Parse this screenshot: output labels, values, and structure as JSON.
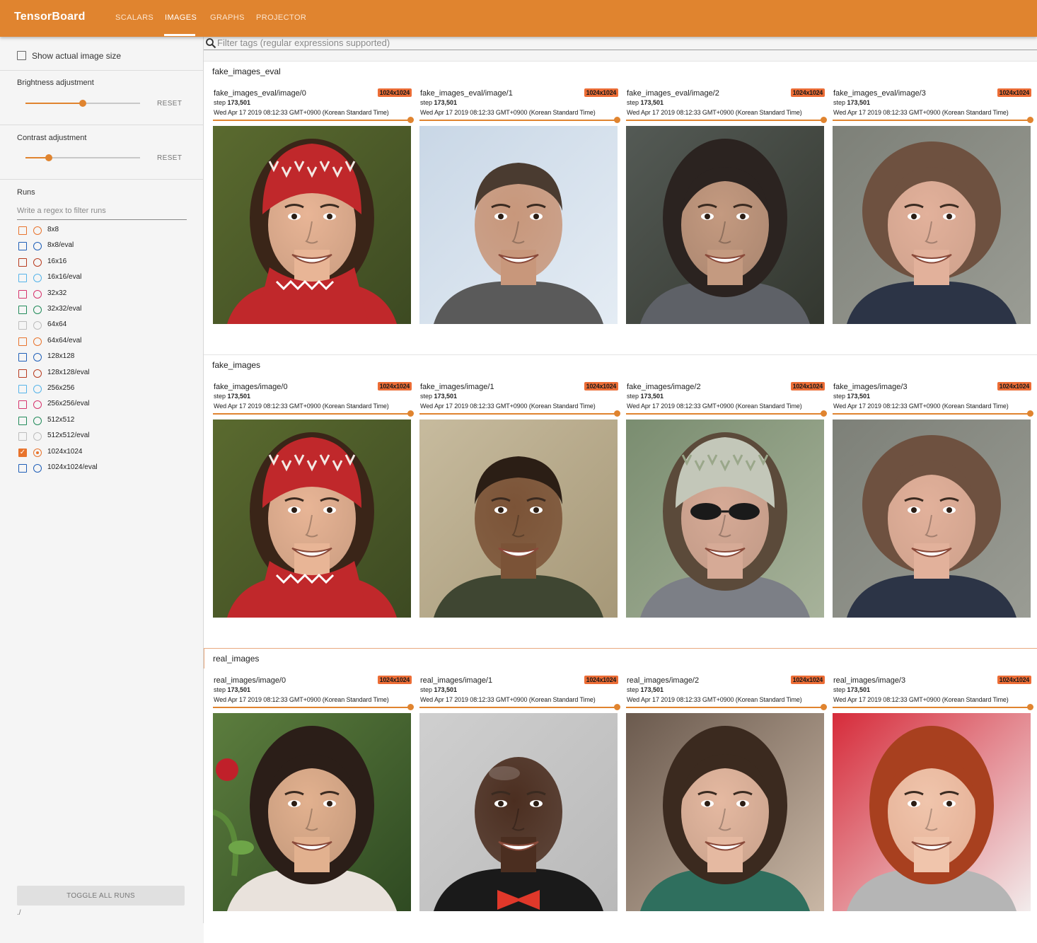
{
  "app": {
    "title": "TensorBoard",
    "tabs": [
      "SCALARS",
      "IMAGES",
      "GRAPHS",
      "PROJECTOR"
    ],
    "active_tab": "IMAGES",
    "accent": "#e0842f"
  },
  "sidebar": {
    "show_actual_size_label": "Show actual image size",
    "show_actual_size_checked": false,
    "brightness_label": "Brightness adjustment",
    "brightness_value": 0.5,
    "contrast_label": "Contrast adjustment",
    "contrast_value": 0.2,
    "reset_label": "RESET",
    "runs_label": "Runs",
    "runs_filter_placeholder": "Write a regex to filter runs",
    "runs": [
      {
        "name": "8x8",
        "color": "#e8742d",
        "checked": false
      },
      {
        "name": "8x8/eval",
        "color": "#1f5fb8",
        "checked": false
      },
      {
        "name": "16x16",
        "color": "#b83b1f",
        "checked": false
      },
      {
        "name": "16x16/eval",
        "color": "#56b4e9",
        "checked": false
      },
      {
        "name": "32x32",
        "color": "#d6336c",
        "checked": false
      },
      {
        "name": "32x32/eval",
        "color": "#228b5a",
        "checked": false
      },
      {
        "name": "64x64",
        "color": "#bdbdbd",
        "checked": false
      },
      {
        "name": "64x64/eval",
        "color": "#e8742d",
        "checked": false
      },
      {
        "name": "128x128",
        "color": "#1f5fb8",
        "checked": false
      },
      {
        "name": "128x128/eval",
        "color": "#b83b1f",
        "checked": false
      },
      {
        "name": "256x256",
        "color": "#56b4e9",
        "checked": false
      },
      {
        "name": "256x256/eval",
        "color": "#d6336c",
        "checked": false
      },
      {
        "name": "512x512",
        "color": "#228b5a",
        "checked": false
      },
      {
        "name": "512x512/eval",
        "color": "#bdbdbd",
        "checked": false
      },
      {
        "name": "1024x1024",
        "color": "#e8742d",
        "checked": true
      },
      {
        "name": "1024x1024/eval",
        "color": "#1f5fb8",
        "checked": false
      }
    ],
    "toggle_all_label": "TOGGLE ALL RUNS",
    "logdir": "./"
  },
  "main": {
    "filter_placeholder": "Filter tags (regular expressions supported)",
    "categories": [
      {
        "name": "fake_images_eval",
        "cards": [
          {
            "tag": "fake_images_eval/image/0",
            "badge": "1024x1024",
            "step_label": "step",
            "step": "173,501",
            "time": "Wed Apr 17 2019 08:12:33 GMT+0900 (Korean Standard Time)",
            "image": "face-portrait-girl-red-hat"
          },
          {
            "tag": "fake_images_eval/image/1",
            "badge": "1024x1024",
            "step_label": "step",
            "step": "173,501",
            "time": "Wed Apr 17 2019 08:12:33 GMT+0900 (Korean Standard Time)",
            "image": "face-portrait-man-short-hair"
          },
          {
            "tag": "fake_images_eval/image/2",
            "badge": "1024x1024",
            "step_label": "step",
            "step": "173,501",
            "time": "Wed Apr 17 2019 08:12:33 GMT+0900 (Korean Standard Time)",
            "image": "face-portrait-woman-dark-hair"
          },
          {
            "tag": "fake_images_eval/image/3",
            "badge": "1024x1024",
            "step_label": "step",
            "step": "173,501",
            "time": "Wed Apr 17 2019 08:12:33 GMT+0900 (Korean Standard Time)",
            "image": "face-portrait-woman-curly-hair"
          }
        ]
      },
      {
        "name": "fake_images",
        "cards": [
          {
            "tag": "fake_images/image/0",
            "badge": "1024x1024",
            "step_label": "step",
            "step": "173,501",
            "time": "Wed Apr 17 2019 08:12:33 GMT+0900 (Korean Standard Time)",
            "image": "face-portrait-girl-red-hat"
          },
          {
            "tag": "fake_images/image/1",
            "badge": "1024x1024",
            "step_label": "step",
            "step": "173,501",
            "time": "Wed Apr 17 2019 08:12:33 GMT+0900 (Korean Standard Time)",
            "image": "face-portrait-man-dark-skin"
          },
          {
            "tag": "fake_images/image/2",
            "badge": "1024x1024",
            "step_label": "step",
            "step": "173,501",
            "time": "Wed Apr 17 2019 08:12:33 GMT+0900 (Korean Standard Time)",
            "image": "face-portrait-woman-sunglasses"
          },
          {
            "tag": "fake_images/image/3",
            "badge": "1024x1024",
            "step_label": "step",
            "step": "173,501",
            "time": "Wed Apr 17 2019 08:12:33 GMT+0900 (Korean Standard Time)",
            "image": "face-portrait-woman-curly-hair"
          }
        ]
      },
      {
        "name": "real_images",
        "cards": [
          {
            "tag": "real_images/image/0",
            "badge": "1024x1024",
            "step_label": "step",
            "step": "173,501",
            "time": "Wed Apr 17 2019 08:12:33 GMT+0900 (Korean Standard Time)",
            "image": "face-portrait-woman-long-hair"
          },
          {
            "tag": "real_images/image/1",
            "badge": "1024x1024",
            "step_label": "step",
            "step": "173,501",
            "time": "Wed Apr 17 2019 08:12:33 GMT+0900 (Korean Standard Time)",
            "image": "face-portrait-man-bald-bowtie"
          },
          {
            "tag": "real_images/image/2",
            "badge": "1024x1024",
            "step_label": "step",
            "step": "173,501",
            "time": "Wed Apr 17 2019 08:12:33 GMT+0900 (Korean Standard Time)",
            "image": "face-portrait-woman-smiling"
          },
          {
            "tag": "real_images/image/3",
            "badge": "1024x1024",
            "step_label": "step",
            "step": "173,501",
            "time": "Wed Apr 17 2019 08:12:33 GMT+0900 (Korean Standard Time)",
            "image": "face-portrait-woman-red-hair"
          }
        ]
      }
    ]
  }
}
